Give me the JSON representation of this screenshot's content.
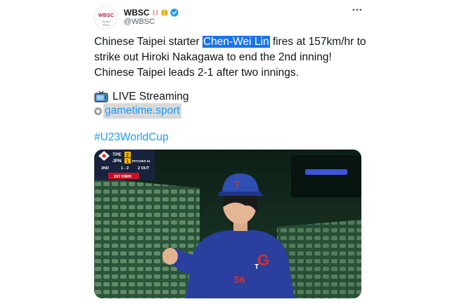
{
  "tweet": {
    "avatar_text": "WBSC",
    "avatar_sub": "Game Time",
    "display_name": "WBSC",
    "handle": "@WBSC",
    "text_lines": [
      {
        "before": "Chinese Taipei starter ",
        "highlight": "Chen-Wei Lin",
        "after": " fires at 157km/hr to"
      },
      {
        "before": "strike out Hiroki Nakagawa to end the 2nd inning!",
        "highlight": "",
        "after": ""
      },
      {
        "before": "Chinese Taipei leads 2-1 after two innings.",
        "highlight": "",
        "after": ""
      }
    ],
    "live_label": "LIVE Streaming",
    "link_text": "gametime.sport",
    "hashtag": "#U23WorldCup"
  },
  "media": {
    "jersey_number": "56",
    "scorebug": {
      "team1": "TPE",
      "team1_score": "2",
      "team2": "JPN",
      "team2_score": "1",
      "pitches_label": "PITCHES 31",
      "inning": "2ND",
      "count": "1 - 2",
      "outs": "2 OUT",
      "speed": "157 KM/H"
    }
  },
  "colors": {
    "link": "#1d9bf0",
    "highlight": "#1a73e8",
    "verified": "#1d9bf0",
    "jersey": "#2a3f9e"
  },
  "icons": [
    "baseball-icon",
    "softball-icon",
    "verified-icon",
    "more-icon",
    "tv-icon",
    "link-icon"
  ]
}
